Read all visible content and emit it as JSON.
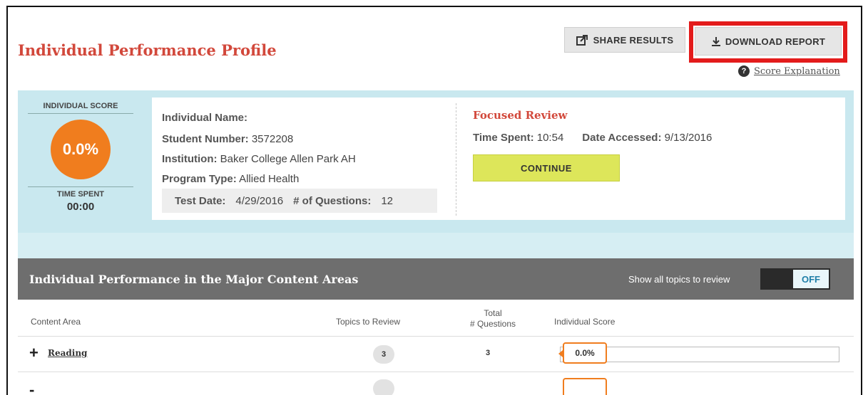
{
  "header": {
    "title": "Individual Performance Profile",
    "share_label": "SHARE RESULTS",
    "download_label": "DOWNLOAD REPORT",
    "score_explanation": "Score Explanation"
  },
  "score": {
    "header": "INDIVIDUAL SCORE",
    "value": "0.0%",
    "time_header": "TIME SPENT",
    "time_value": "00:00"
  },
  "student": {
    "name_label": "Individual Name:",
    "name_value": "",
    "number_label": "Student Number:",
    "number_value": "3572208",
    "institution_label": "Institution:",
    "institution_value": "Baker College Allen Park AH",
    "program_label": "Program Type:",
    "program_value": "Allied Health",
    "test_date_label": "Test Date:",
    "test_date_value": "4/29/2016",
    "questions_label": "# of Questions:",
    "questions_value": "12"
  },
  "focused_review": {
    "title": "Focused Review",
    "time_label": "Time Spent:",
    "time_value": "10:54",
    "date_label": "Date Accessed:",
    "date_value": "9/13/2016",
    "continue_label": "CONTINUE"
  },
  "content_areas": {
    "title": "Individual Performance in the Major Content Areas",
    "show_label": "Show all topics to review",
    "toggle_state": "OFF",
    "columns": {
      "area": "Content Area",
      "topics": "Topics to Review",
      "total_line1": "Total",
      "total_line2": "# Questions",
      "score": "Individual Score"
    },
    "rows": [
      {
        "name": "Reading",
        "topics": "3",
        "total": "3",
        "score": "0.0%"
      }
    ]
  },
  "colors": {
    "accent_red": "#d2483b",
    "score_orange": "#f07d1e",
    "continue_yellow": "#dde65a",
    "highlight_box": "#e31b1b"
  }
}
